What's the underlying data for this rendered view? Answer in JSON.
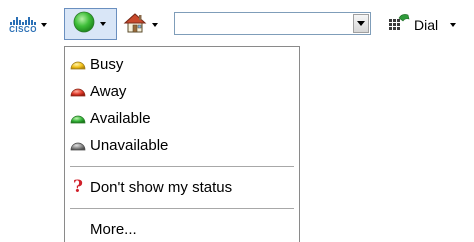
{
  "toolbar": {
    "cisco_logo_text": "CISCO",
    "dial_label": "Dial",
    "search": {
      "value": "",
      "placeholder": ""
    }
  },
  "status_menu": {
    "items": [
      {
        "label": "Busy",
        "icon": "yellow-status-icon",
        "color": "#f2c21a"
      },
      {
        "label": "Away",
        "icon": "red-status-icon",
        "color": "#e03b2b"
      },
      {
        "label": "Available",
        "icon": "green-status-icon",
        "color": "#35b33a"
      },
      {
        "label": "Unavailable",
        "icon": "gray-status-icon",
        "color": "#8a8a8a"
      }
    ],
    "dont_show": {
      "label": "Don't show my status",
      "icon": "question-mark-icon",
      "color": "#d0202a"
    },
    "more": {
      "label": "More..."
    }
  },
  "colors": {
    "selected_button_bg": "#d9e6f7",
    "selected_button_border": "#6a8fbf",
    "cisco_blue": "#2a6fb5"
  }
}
